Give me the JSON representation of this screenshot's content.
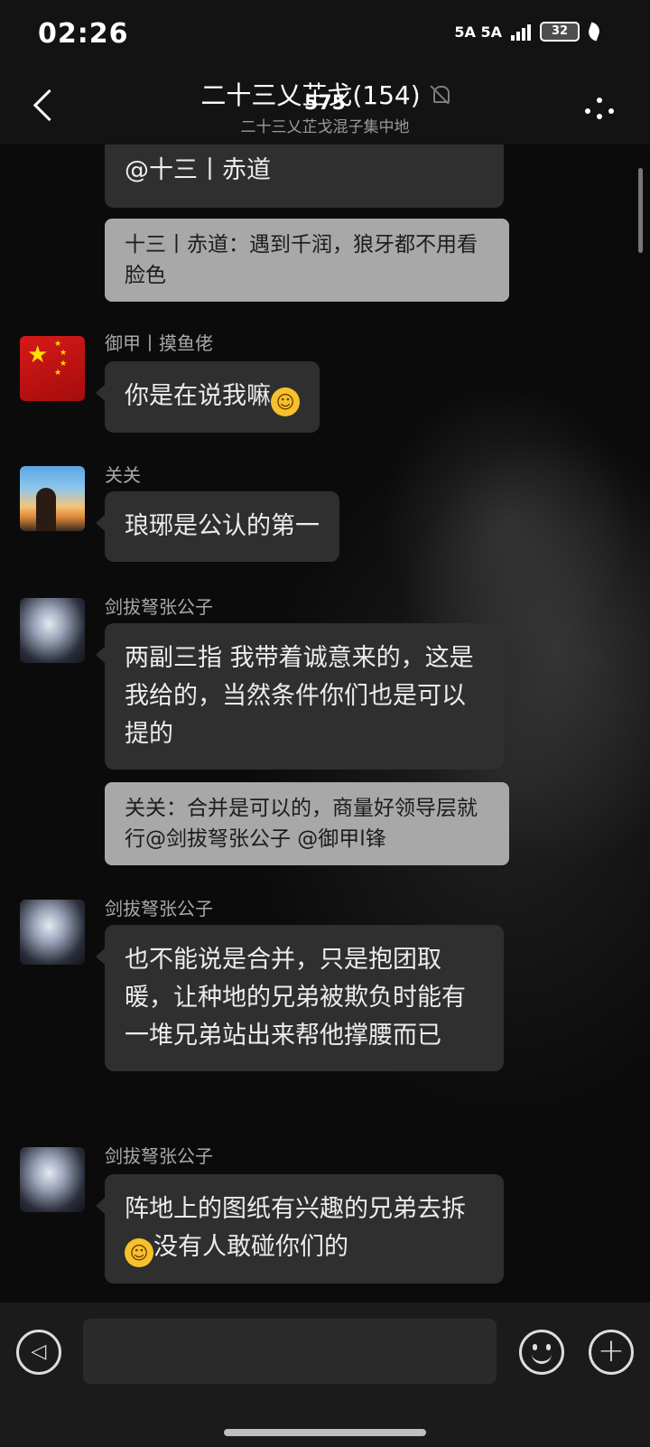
{
  "status_bar": {
    "time": "02:26",
    "indicators": "5A 5A",
    "battery": "32"
  },
  "header": {
    "title": "二十三乂芷戈(154)",
    "subtitle": "二十三乂芷戈混子集中地",
    "unread_count": "575"
  },
  "messages": [
    {
      "id": "m0",
      "type": "text",
      "text": "@十三丨赤道"
    },
    {
      "id": "m0q",
      "type": "quote",
      "text": "十三丨赤道：遇到千润，狼牙都不用看脸色"
    },
    {
      "id": "m1",
      "sender": "御甲丨摸鱼佬",
      "avatar": "china-flag",
      "text": "你是在说我嘛",
      "emoji": "grinning"
    },
    {
      "id": "m2",
      "sender": "关关",
      "avatar": "sunset-person",
      "text": "琅琊是公认的第一"
    },
    {
      "id": "m3",
      "sender": "剑拔弩张公子",
      "avatar": "anime-character",
      "text": "两副三指 我带着诚意来的，这是我给的，当然条件你们也是可以提的"
    },
    {
      "id": "m3q",
      "type": "quote",
      "text": "关关：合并是可以的，商量好领导层就行@剑拔弩张公子 @御甲l锋"
    },
    {
      "id": "m4",
      "sender": "剑拔弩张公子",
      "avatar": "anime-character",
      "text": "也不能说是合并，只是抱团取暖，让种地的兄弟被欺负时能有一堆兄弟站出来帮他撑腰而已"
    },
    {
      "id": "m5",
      "sender": "剑拔弩张公子",
      "avatar": "anime-character",
      "text_before": "阵地上的图纸有兴趣的兄弟去拆",
      "emoji": "smirking",
      "text_after": "没有人敢碰你们的"
    }
  ],
  "icons": {
    "back": "back-arrow-icon",
    "more": "more-dots-icon",
    "mute": "mute-bell-icon",
    "voice": "voice-icon",
    "emoji": "emoji-icon",
    "plus": "plus-icon"
  }
}
